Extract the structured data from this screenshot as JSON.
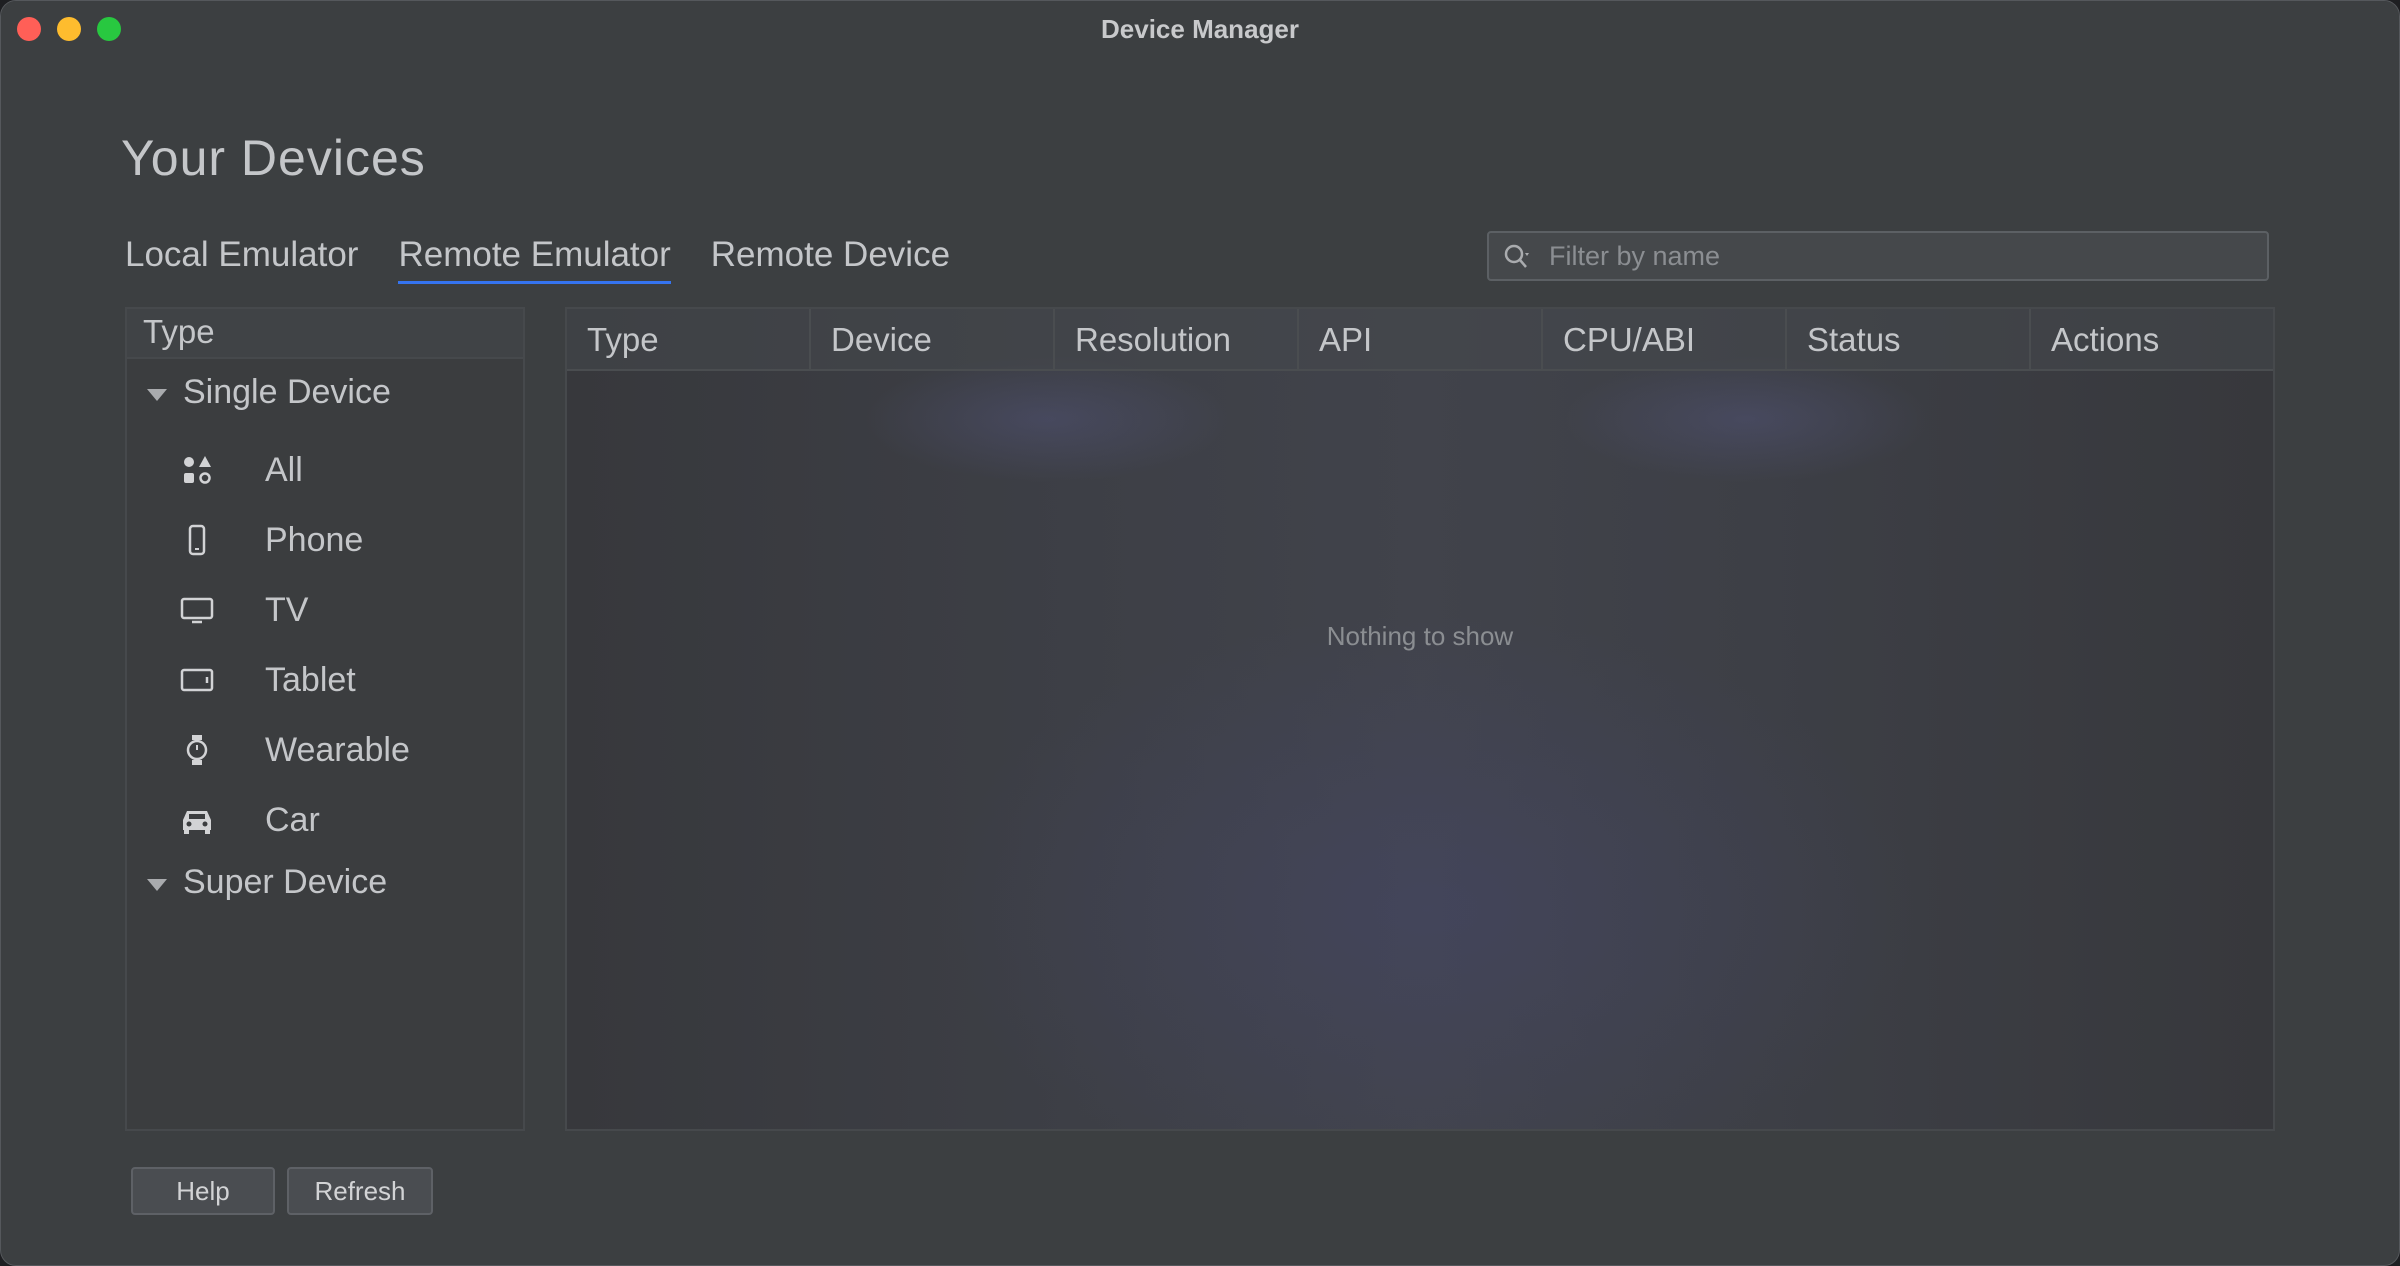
{
  "window": {
    "title": "Device Manager"
  },
  "page": {
    "title": "Your Devices"
  },
  "tabs": [
    {
      "label": "Local Emulator",
      "active": false
    },
    {
      "label": "Remote Emulator",
      "active": true
    },
    {
      "label": "Remote Device",
      "active": false
    }
  ],
  "search": {
    "placeholder": "Filter by name",
    "value": ""
  },
  "type_panel": {
    "header": "Type",
    "groups": [
      {
        "label": "Single Device",
        "expanded": true
      },
      {
        "label": "Super Device",
        "expanded": true
      }
    ],
    "items": [
      {
        "label": "All",
        "icon": "grid-shapes-icon"
      },
      {
        "label": "Phone",
        "icon": "phone-icon"
      },
      {
        "label": "TV",
        "icon": "tv-icon"
      },
      {
        "label": "Tablet",
        "icon": "tablet-icon"
      },
      {
        "label": "Wearable",
        "icon": "watch-icon"
      },
      {
        "label": "Car",
        "icon": "car-icon"
      }
    ]
  },
  "table": {
    "columns": [
      "Type",
      "Device",
      "Resolution",
      "API",
      "CPU/ABI",
      "Status",
      "Actions"
    ],
    "empty_text": "Nothing to show"
  },
  "buttons": {
    "help": "Help",
    "refresh": "Refresh"
  },
  "colors": {
    "accent": "#3574f0",
    "background": "#3c3f41",
    "text": "#c4c6c9"
  }
}
